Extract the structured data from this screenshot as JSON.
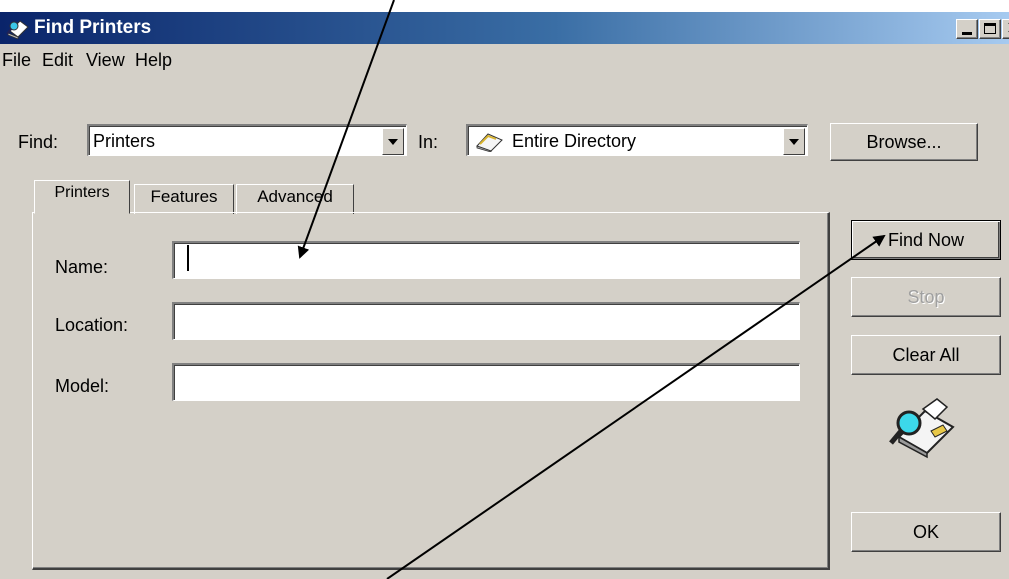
{
  "window": {
    "title": "Find Printers",
    "title_icon": "find-printers-icon",
    "colors": {
      "title_start": "#0a246a",
      "title_end": "#a6caf0",
      "face": "#d4d0c8"
    }
  },
  "menu": {
    "items": [
      "File",
      "Edit",
      "View",
      "Help"
    ]
  },
  "find_bar": {
    "find_label": "Find:",
    "find_value": "Printers",
    "in_label": "In:",
    "in_value": "Entire Directory",
    "in_icon": "directory-icon",
    "browse_label": "Browse..."
  },
  "tabs": {
    "items": [
      "Printers",
      "Features",
      "Advanced"
    ],
    "active": "Printers"
  },
  "fields": {
    "name_label": "Name:",
    "name_value": "",
    "location_label": "Location:",
    "location_value": "",
    "model_label": "Model:",
    "model_value": ""
  },
  "actions": {
    "find_now_label": "Find Now",
    "stop_label": "Stop",
    "clear_all_label": "Clear All",
    "ok_label": "OK",
    "search_icon": "magnifier-printer-icon"
  }
}
